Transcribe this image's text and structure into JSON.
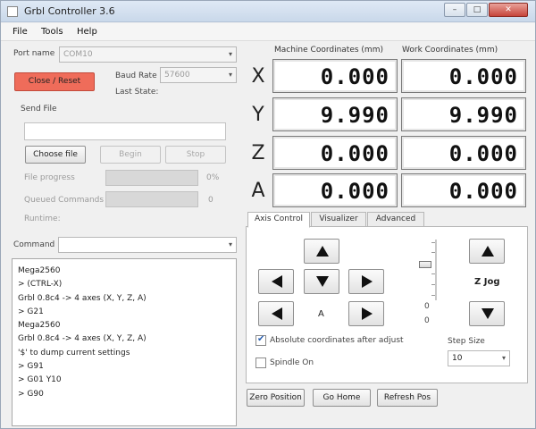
{
  "window": {
    "title": "Grbl Controller 3.6",
    "min_glyph": "–",
    "max_glyph": "□",
    "close_glyph": "✕"
  },
  "menu": [
    "File",
    "Tools",
    "Help"
  ],
  "connection": {
    "port_label": "Port name",
    "port_value": "COM10",
    "reset_button": "Close / Reset",
    "baud_label": "Baud Rate",
    "baud_value": "57600",
    "last_state_label": "Last State:"
  },
  "send_file": {
    "label": "Send File",
    "choose_button": "Choose file",
    "begin_button": "Begin",
    "stop_button": "Stop",
    "progress_label": "File progress",
    "progress_value": "0%",
    "progress_fraction": 0,
    "queued_label": "Queued Commands",
    "queued_value": "0",
    "runtime_label": "Runtime:"
  },
  "command": {
    "label": "Command",
    "value": ""
  },
  "console": [
    "Mega2560",
    "> (CTRL-X)",
    "Grbl 0.8c4 -> 4 axes (X, Y, Z, A)",
    "> G21",
    "Mega2560",
    "Grbl 0.8c4 -> 4 axes (X, Y, Z, A)",
    "'$' to dump current settings",
    "> G91",
    "> G01 Y10",
    "> G90"
  ],
  "coordinates": {
    "machine_header": "Machine Coordinates  (mm)",
    "work_header": "Work Coordinates  (mm)",
    "axes": [
      {
        "letter": "X",
        "machine": "0.000",
        "work": "0.000"
      },
      {
        "letter": "Y",
        "machine": "9.990",
        "work": "9.990"
      },
      {
        "letter": "Z",
        "machine": "0.000",
        "work": "0.000"
      },
      {
        "letter": "A",
        "machine": "0.000",
        "work": "0.000"
      }
    ]
  },
  "tabs": [
    "Axis Control",
    "Visualizer",
    "Advanced"
  ],
  "axis_control": {
    "a_label": "A",
    "z_jog_label": "Z Jog",
    "slider_value_1": "0",
    "slider_value_2": "0",
    "absolute_label": "Absolute coordinates after adjust",
    "absolute_checked": true,
    "spindle_label": "Spindle On",
    "spindle_checked": false,
    "step_size_label": "Step Size",
    "step_size_value": "10"
  },
  "bottom_buttons": {
    "zero_position": "Zero Position",
    "go_home": "Go Home",
    "refresh_pos": "Refresh Pos"
  }
}
